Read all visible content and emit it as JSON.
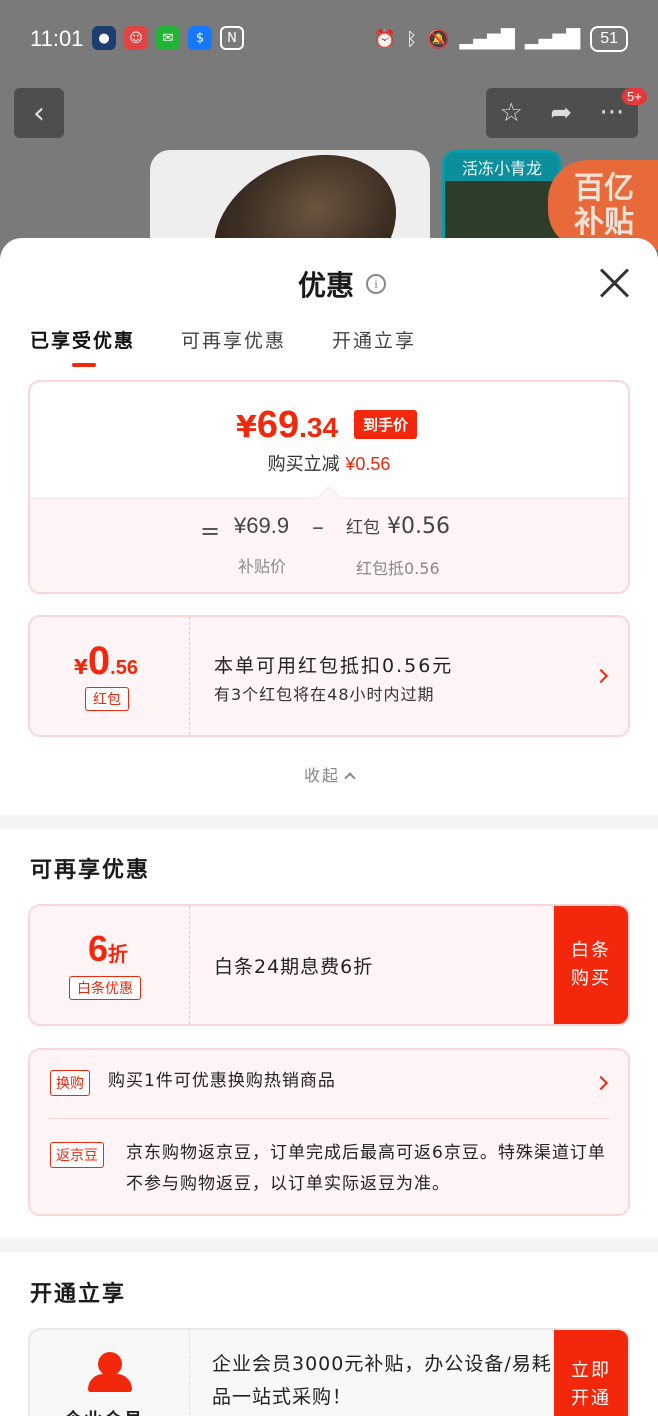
{
  "status": {
    "time": "11:01",
    "battery": "51"
  },
  "background": {
    "nav_badge": "5+",
    "thumb_label": "活冻小青龙",
    "promo_text_1": "百亿",
    "promo_text_2": "补贴"
  },
  "sheet": {
    "title": "优惠",
    "tabs": [
      "已享受优惠",
      "可再享优惠",
      "开通立享"
    ],
    "price": {
      "yen": "¥",
      "int": "69",
      "dec": ".34",
      "badge": "到手价",
      "sub_prefix": "购买立减",
      "sub_amount": "¥0.56",
      "calc_eq": "=",
      "calc_a": "¥69.9",
      "calc_a_label": "补贴价",
      "calc_minus": "–",
      "calc_b_prefix": "红包",
      "calc_b_amount": "¥0.56",
      "calc_b_label": "红包抵0.56"
    },
    "coupon": {
      "yen": "¥",
      "int": "0",
      "dec": ".56",
      "tag": "红包",
      "line1": "本单可用红包抵扣0.56元",
      "line2": "有3个红包将在48小时内过期"
    },
    "collapse_label": "收起"
  },
  "more": {
    "title": "可再享优惠",
    "baitiao": {
      "discount": "6",
      "unit": "折",
      "tag": "白条优惠",
      "text": "白条24期息费6折",
      "button": "白条购买"
    },
    "exchange": {
      "tag": "换购",
      "text": "购买1件可优惠换购热销商品"
    },
    "jingdou": {
      "tag": "返京豆",
      "text": "京东购物返京豆，订单完成后最高可返6京豆。特殊渠道订单不参与购物返豆，以订单实际返豆为准。"
    }
  },
  "open": {
    "title": "开通立享",
    "member": {
      "label": "企业会员",
      "text": "企业会员3000元补贴，办公设备/易耗品一站式采购！",
      "button": "立即开通"
    }
  }
}
